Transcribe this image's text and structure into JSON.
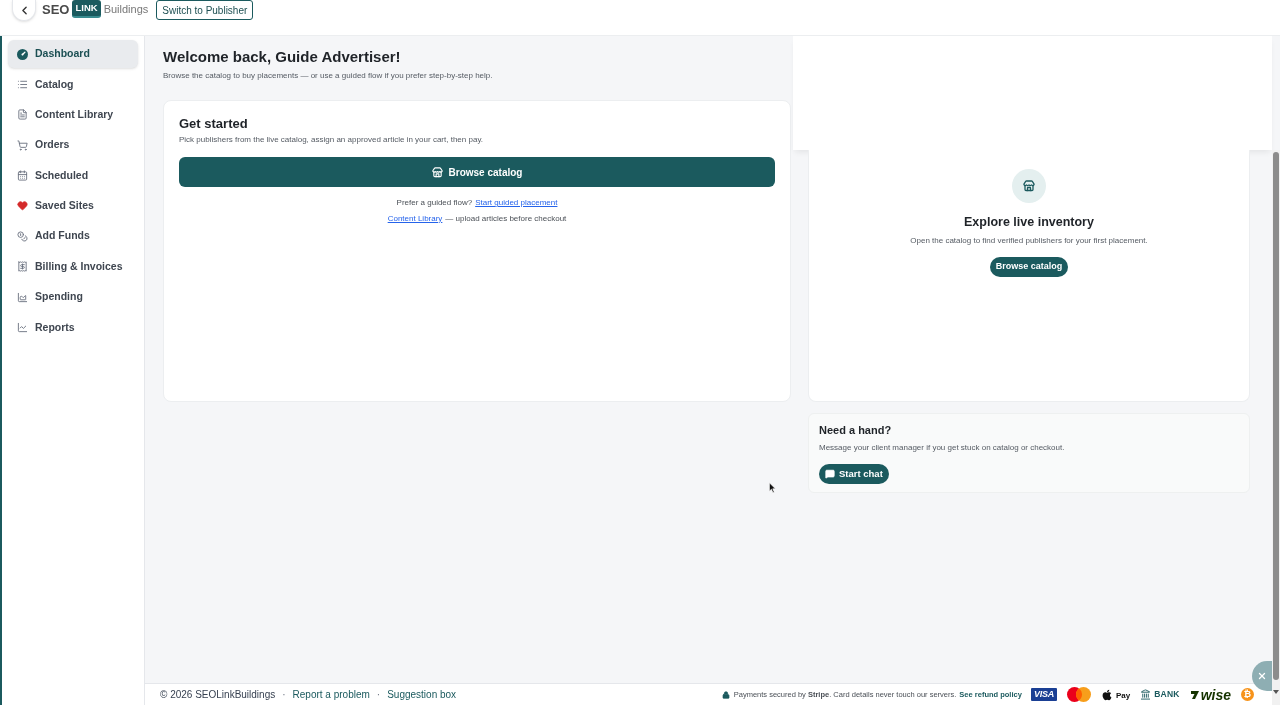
{
  "header": {
    "logo": {
      "part_1": "SEO",
      "part_2": "LINK",
      "part_3": "Buildings"
    },
    "switch_button": "Switch to Publisher"
  },
  "sidebar": {
    "items": [
      {
        "label": "Dashboard",
        "selected": true
      },
      {
        "label": "Catalog",
        "selected": false
      },
      {
        "label": "Content Library",
        "selected": false
      },
      {
        "label": "Orders",
        "selected": false
      },
      {
        "label": "Scheduled",
        "selected": false
      },
      {
        "label": "Saved Sites",
        "selected": false
      },
      {
        "label": "Add Funds",
        "selected": false
      },
      {
        "label": "Billing & Invoices",
        "selected": false
      },
      {
        "label": "Spending",
        "selected": false
      },
      {
        "label": "Reports",
        "selected": false
      }
    ]
  },
  "main": {
    "title": "Welcome back, Guide Advertiser!",
    "subtitle": "Browse the catalog to buy placements — or use a guided flow if you prefer step-by-step help.",
    "get_started": {
      "title": "Get started",
      "description": "Pick publishers from the live catalog, assign an approved article in your cart, then pay.",
      "button": "Browse catalog",
      "guided_prompt": "Prefer a guided flow?",
      "guided_link": "Start guided placement",
      "library_link": "Content Library",
      "library_note": "— upload articles before checkout"
    }
  },
  "explore": {
    "title": "Explore live inventory",
    "description": "Open the catalog to find verified publishers for your first placement.",
    "button": "Browse catalog"
  },
  "help": {
    "title": "Need a hand?",
    "description": "Message your client manager if you get stuck on catalog or checkout.",
    "button": "Start chat"
  },
  "footer": {
    "left": [
      {
        "kind": "text",
        "text": "© 2026 SEOLinkBuildings"
      },
      {
        "kind": "separator",
        "text": "·"
      },
      {
        "kind": "link",
        "text": "Report a problem"
      },
      {
        "kind": "separator",
        "text": "·"
      },
      {
        "kind": "link",
        "text": "Suggestion box"
      }
    ],
    "security_note": "Payments secured by **Stripe**. Card details never touch our servers.",
    "refund_link": "See refund policy",
    "payment_methods": [
      {
        "kind": "visa",
        "label": "VISA"
      },
      {
        "kind": "mastercard"
      },
      {
        "kind": "apple_pay",
        "label": "Pay"
      },
      {
        "kind": "bank",
        "label": "BANK"
      },
      {
        "kind": "wise",
        "label": "wise"
      },
      {
        "kind": "bitcoin",
        "label": "₿"
      }
    ]
  }
}
